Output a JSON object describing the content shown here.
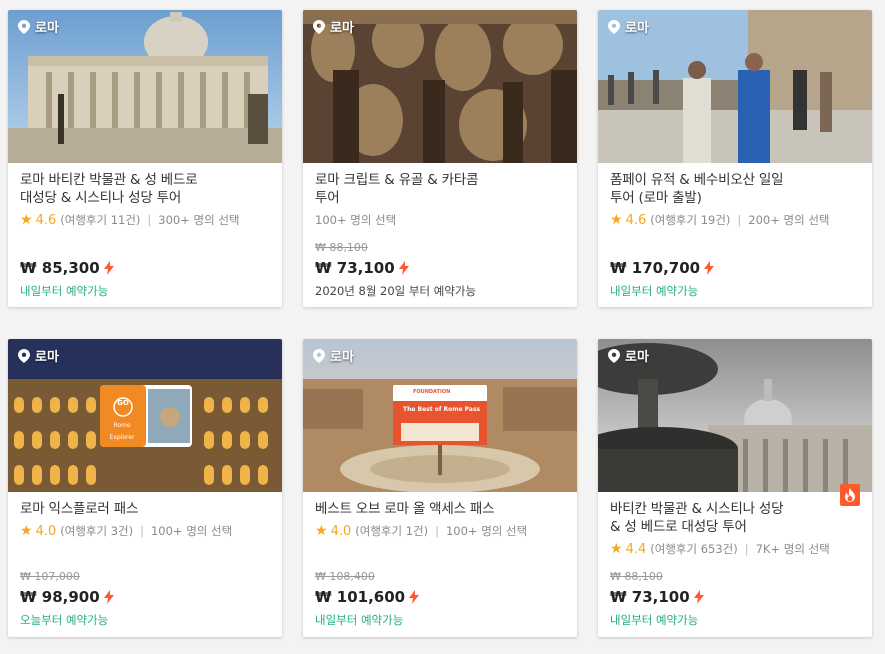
{
  "colors": {
    "accent_orange": "#ff5a2b",
    "rating_star": "#f5a623",
    "availability_green": "#23b07d",
    "text_dark": "#333333"
  },
  "cards": [
    {
      "location": "로마",
      "title_line1": "로마 바티칸 박물관 & 성 베드로",
      "title_line2": "대성당 & 시스티나 성당 투어",
      "star": "★",
      "rating": "4.6",
      "reviews": "(여행후기 11건)",
      "separator": "|",
      "bookings": "300+ 명의 선택",
      "original_price": "",
      "price": "₩ 85,300",
      "availability": "내일부터 예약가능",
      "icon": "bolt-icon"
    },
    {
      "location": "로마",
      "title_line1": "로마 크립트 & 유골 & 카타콤",
      "title_line2": "투어",
      "star": "",
      "rating": "",
      "reviews": "",
      "separator": "",
      "bookings": "100+ 명의 선택",
      "original_price": "₩ 88,100",
      "price": "₩ 73,100",
      "availability": "2020년 8월 20일 부터 예약가능",
      "icon": "bolt-icon"
    },
    {
      "location": "로마",
      "title_line1": "폼페이 유적 & 베수비오산 일일",
      "title_line2": "투어 (로마 출발)",
      "star": "★",
      "rating": "4.6",
      "reviews": "(여행후기 19건)",
      "separator": "|",
      "bookings": "200+ 명의 선택",
      "original_price": "",
      "price": "₩ 170,700",
      "availability": "내일부터 예약가능",
      "icon": "bolt-icon"
    },
    {
      "location": "로마",
      "title_line1": "로마 익스플로러 패스",
      "title_line2": "",
      "star": "★",
      "rating": "4.0",
      "reviews": "(여행후기 3건)",
      "separator": "|",
      "bookings": "100+ 명의 선택",
      "original_price": "₩ 107,000",
      "price": "₩ 98,900",
      "availability": "오늘부터 예약가능",
      "icon": "bolt-icon",
      "thumb_card": {
        "logo": "GO",
        "brand": "Rome",
        "sub": "Explorer"
      }
    },
    {
      "location": "로마",
      "title_line1": "베스트 오브 로마 올 액세스 패스",
      "title_line2": "",
      "star": "★",
      "rating": "4.0",
      "reviews": "(여행후기 1건)",
      "separator": "|",
      "bookings": "100+ 명의 선택",
      "original_price": "₩ 108,400",
      "price": "₩ 101,600",
      "availability": "내일부터 예약가능",
      "icon": "bolt-icon",
      "thumb_card": {
        "brand": "FOUNDATION",
        "sub": "The Best of Rome Pass"
      }
    },
    {
      "location": "로마",
      "title_line1": "바티칸 박물관 & 시스티나 성당",
      "title_line2": "& 성 베드로 대성당 투어",
      "star": "★",
      "rating": "4.4",
      "reviews": "(여행후기 653건)",
      "separator": "|",
      "bookings": "7K+ 명의 선택",
      "original_price": "₩ 88,100",
      "price": "₩ 73,100",
      "availability": "내일부터 예약가능",
      "icon": "bolt-icon",
      "badge": "hot-badge-icon"
    }
  ]
}
